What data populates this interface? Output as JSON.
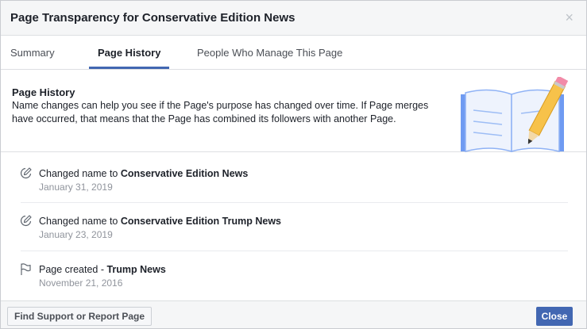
{
  "dialog": {
    "title": "Page Transparency for Conservative Edition News",
    "close_symbol": "×"
  },
  "tabs": [
    {
      "label": "Summary"
    },
    {
      "label": "Page History"
    },
    {
      "label": "People Who Manage This Page"
    }
  ],
  "intro": {
    "heading": "Page History",
    "description": "Name changes can help you see if the Page's purpose has changed over time. If Page merges have occurred, that means that the Page has combined its followers with another Page.",
    "illustration": "book-pencil-illustration"
  },
  "history": [
    {
      "icon": "edit-icon",
      "prefix": "Changed name to ",
      "name": "Conservative Edition News",
      "date": "January 31, 2019"
    },
    {
      "icon": "edit-icon",
      "prefix": "Changed name to ",
      "name": "Conservative Edition Trump News",
      "date": "January 23, 2019"
    },
    {
      "icon": "flag-icon",
      "prefix": "Page created - ",
      "name": "Trump News",
      "date": "November 21, 2016"
    }
  ],
  "footer": {
    "support_label": "Find Support or Report Page",
    "close_label": "Close"
  },
  "colors": {
    "accent": "#4267b2",
    "header_bg": "#f5f6f7",
    "date_text": "#90949c"
  }
}
